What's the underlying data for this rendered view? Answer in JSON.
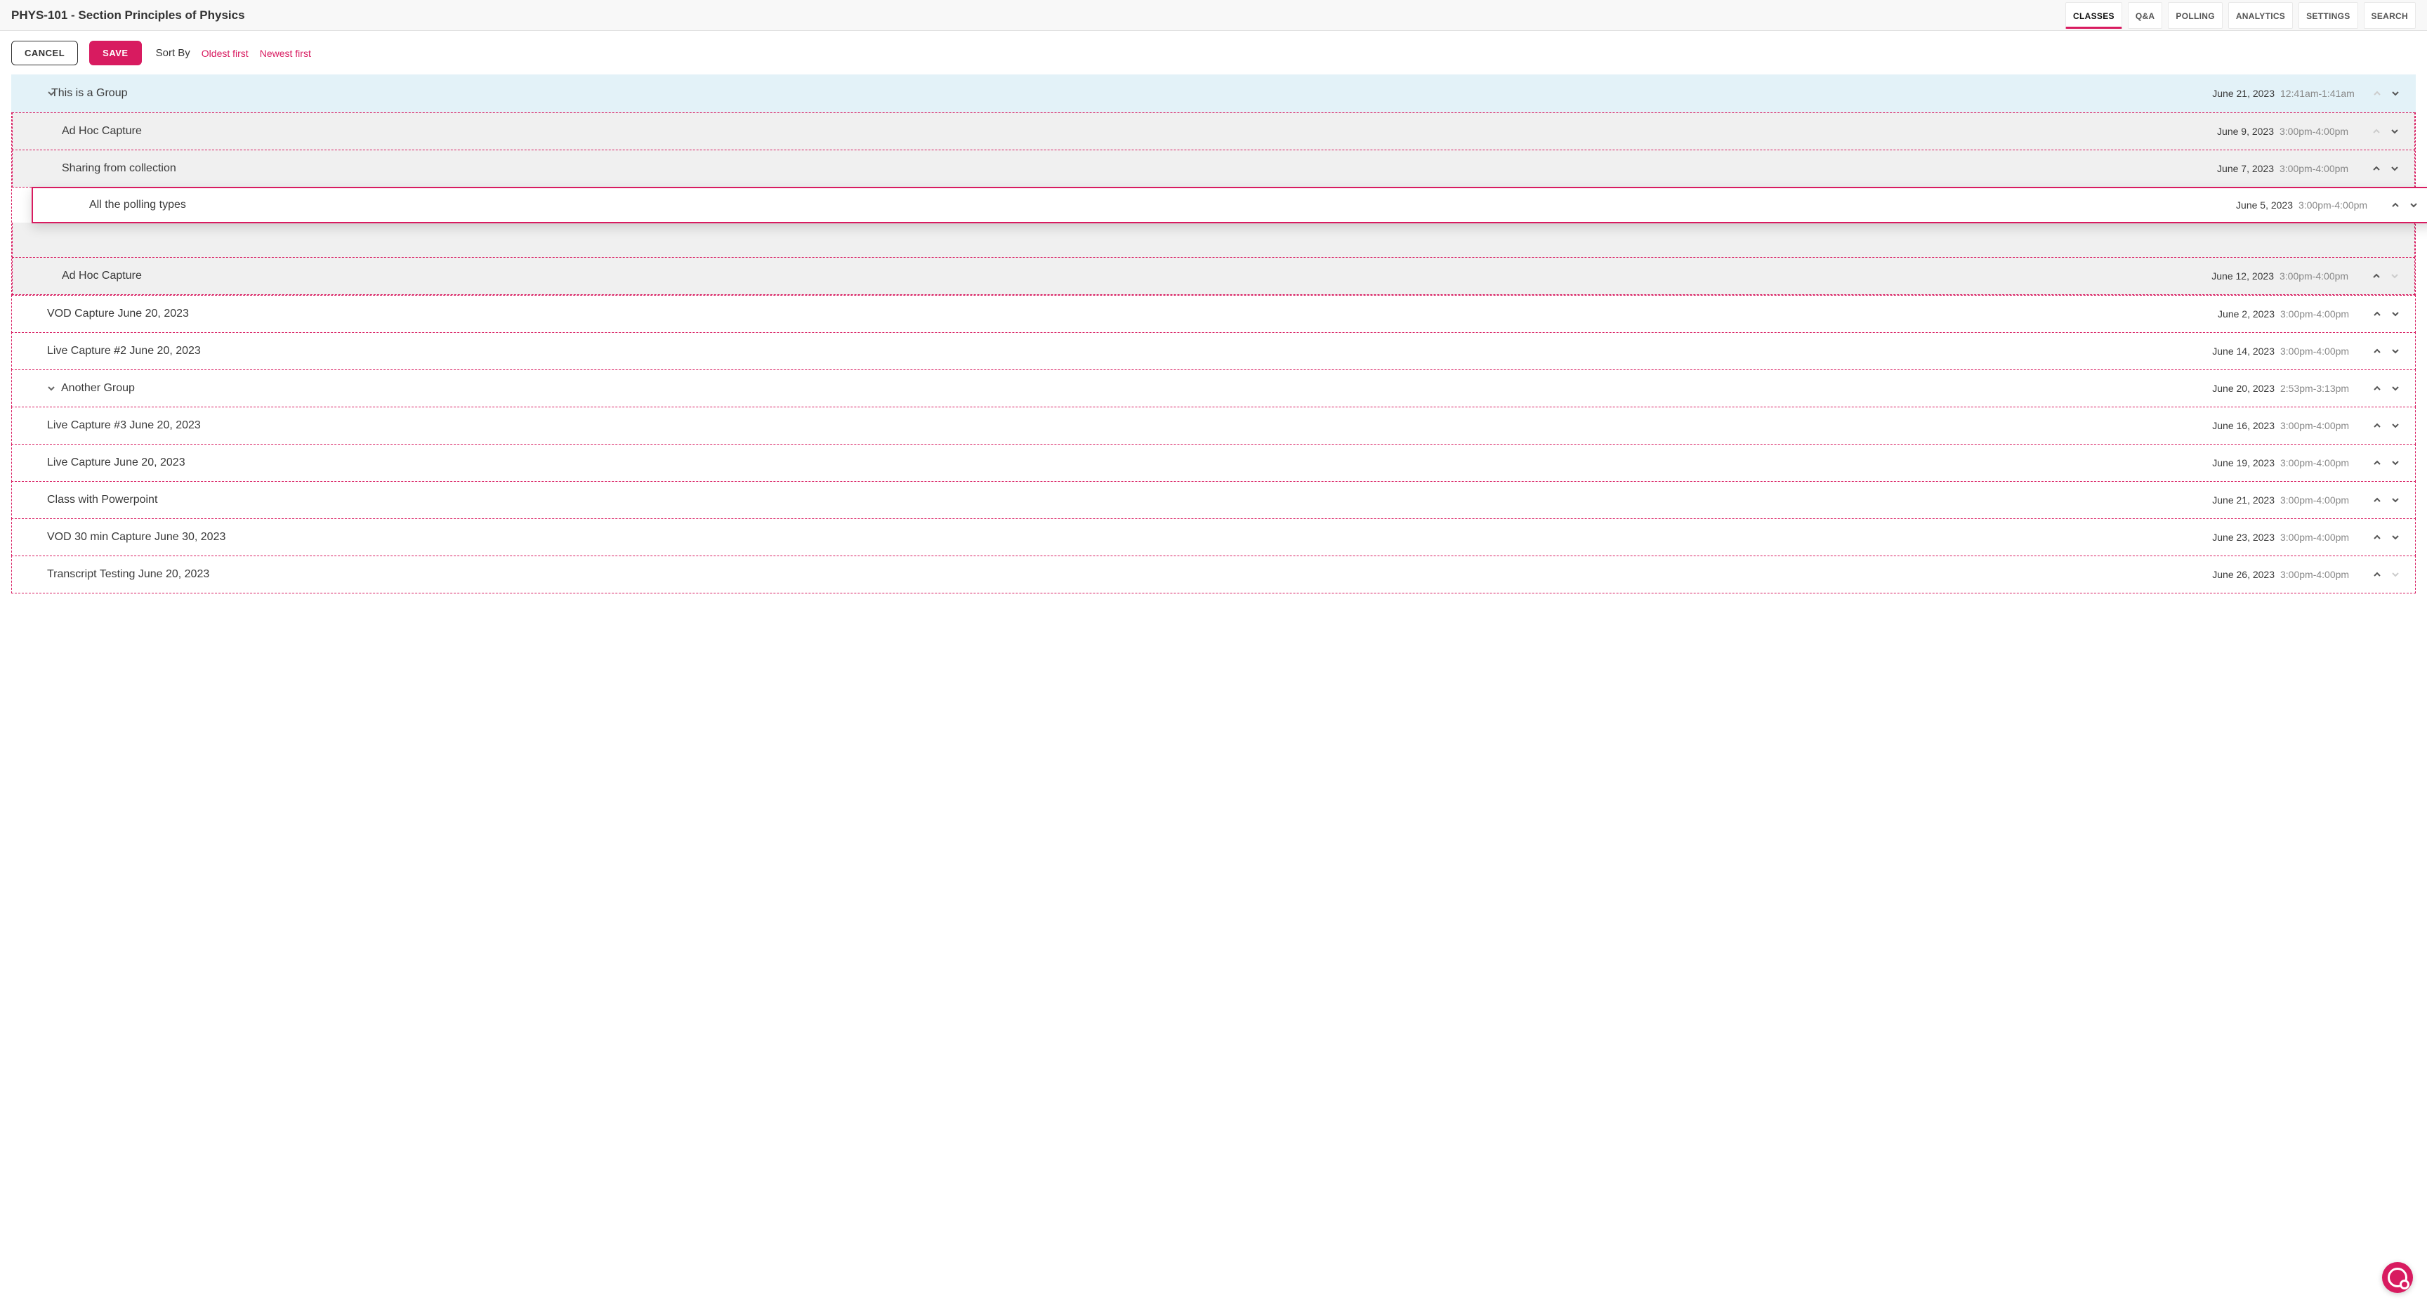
{
  "header": {
    "title": "PHYS-101 - Section Principles of Physics",
    "tabs": [
      {
        "label": "CLASSES",
        "active": true
      },
      {
        "label": "Q&A"
      },
      {
        "label": "POLLING"
      },
      {
        "label": "ANALYTICS"
      },
      {
        "label": "SETTINGS"
      },
      {
        "label": "SEARCH"
      }
    ]
  },
  "toolbar": {
    "cancel_label": "CANCEL",
    "save_label": "SAVE",
    "sortby_label": "Sort By",
    "oldest_label": "Oldest first",
    "newest_label": "Newest first"
  },
  "rows": [
    {
      "kind": "group-header",
      "title": "This is a Group",
      "date": "June 21, 2023",
      "time": "12:41am-1:41am",
      "up_disabled": true,
      "chevron": true
    },
    {
      "kind": "nested",
      "title": "Ad Hoc Capture",
      "date": "June 9, 2023",
      "time": "3:00pm-4:00pm",
      "up_disabled": true
    },
    {
      "kind": "nested",
      "title": "Sharing from collection",
      "date": "June 7, 2023",
      "time": "3:00pm-4:00pm"
    },
    {
      "kind": "dragging",
      "title": "All the polling types",
      "date": "June 5, 2023",
      "time": "3:00pm-4:00pm"
    },
    {
      "kind": "spacer"
    },
    {
      "kind": "nested",
      "title": "Ad Hoc Capture",
      "date": "June 12, 2023",
      "time": "3:00pm-4:00pm",
      "down_disabled": true
    },
    {
      "kind": "item",
      "title": "VOD Capture June 20, 2023",
      "date": "June 2, 2023",
      "time": "3:00pm-4:00pm"
    },
    {
      "kind": "item",
      "title": "Live Capture #2 June 20, 2023",
      "date": "June 14, 2023",
      "time": "3:00pm-4:00pm"
    },
    {
      "kind": "item",
      "title": "Another Group",
      "date": "June 20, 2023",
      "time": "2:53pm-3:13pm",
      "chevron": true
    },
    {
      "kind": "item",
      "title": "Live Capture #3 June 20, 2023",
      "date": "June 16, 2023",
      "time": "3:00pm-4:00pm"
    },
    {
      "kind": "item",
      "title": "Live Capture June 20, 2023",
      "date": "June 19, 2023",
      "time": "3:00pm-4:00pm"
    },
    {
      "kind": "item",
      "title": "Class with Powerpoint",
      "date": "June 21, 2023",
      "time": "3:00pm-4:00pm"
    },
    {
      "kind": "item",
      "title": "VOD 30 min Capture June 30, 2023",
      "date": "June 23, 2023",
      "time": "3:00pm-4:00pm"
    },
    {
      "kind": "item",
      "title": "Transcript Testing June 20, 2023",
      "date": "June 26, 2023",
      "time": "3:00pm-4:00pm",
      "down_disabled": true
    }
  ],
  "fab": {
    "glyph": "e"
  }
}
